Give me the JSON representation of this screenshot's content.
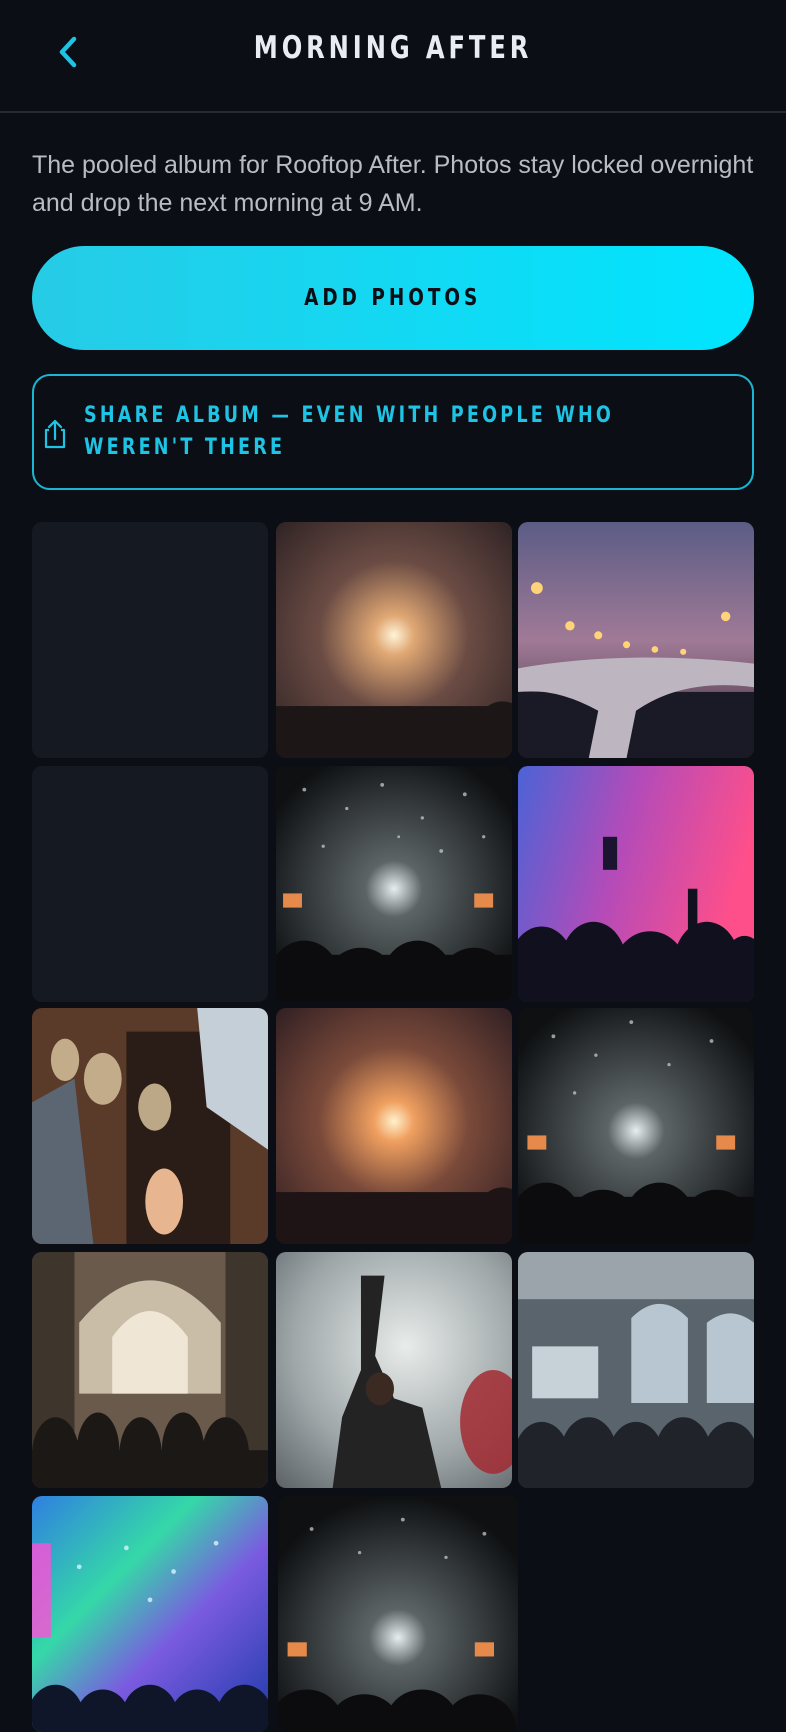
{
  "header": {
    "title": "MORNING AFTER",
    "back_icon": "chevron-left-icon"
  },
  "description": "The pooled album for Rooftop After. Photos stay locked overnight and drop the next morning at 9 AM.",
  "actions": {
    "add_photos_label": "ADD PHOTOS",
    "share_label": "SHARE ALBUM — EVEN WITH PEOPLE WHO WEREN'T THERE",
    "share_icon": "share-icon"
  },
  "colors": {
    "accent": "#00e5ff",
    "accent_border": "#19b7d4",
    "background": "#0b0e14",
    "placeholder_tile": "#151a22"
  },
  "photos": [
    {
      "kind": "placeholder"
    },
    {
      "kind": "concert-warm-stage-lights"
    },
    {
      "kind": "bridge-at-dusk-with-lamps"
    },
    {
      "kind": "placeholder"
    },
    {
      "kind": "concert-confetti-crowd"
    },
    {
      "kind": "concert-pink-blue-lights"
    },
    {
      "kind": "people-clinking-wine-glasses"
    },
    {
      "kind": "concert-warm-stage-lights"
    },
    {
      "kind": "concert-confetti-crowd"
    },
    {
      "kind": "crowd-in-ornate-arcade-hall"
    },
    {
      "kind": "performer-arm-raised-in-smoke"
    },
    {
      "kind": "crowd-in-event-hall-with-screen"
    },
    {
      "kind": "festival-rainbow-lights"
    },
    {
      "kind": "concert-confetti-crowd"
    }
  ]
}
